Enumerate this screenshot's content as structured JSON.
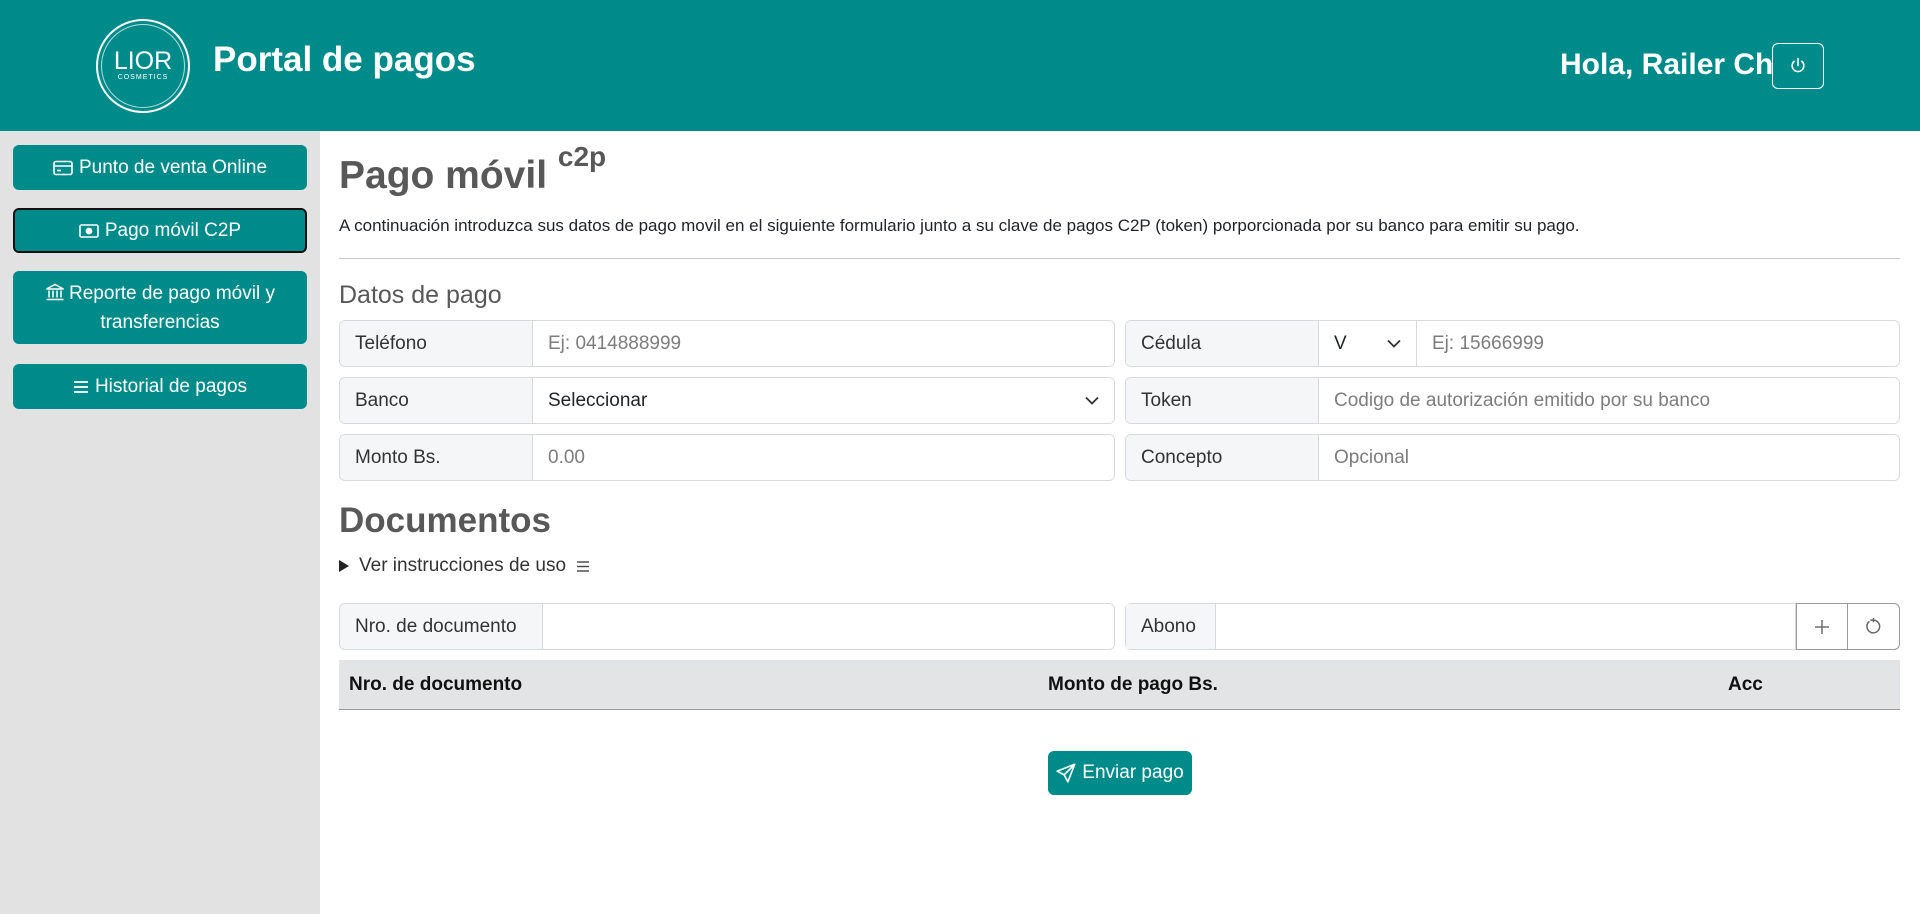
{
  "header": {
    "logo_text": "LIOR",
    "logo_subtext": "COSMETICS",
    "title": "Portal de pagos",
    "greeting": "Hola, Railer Ch"
  },
  "sidebar": {
    "items": [
      {
        "label": "Punto de venta Online",
        "icon": "card-icon"
      },
      {
        "label": "Pago móvil C2P",
        "icon": "cash-icon",
        "active": true
      },
      {
        "label": "Reporte de pago móvil y transferencias",
        "icon": "bank-icon"
      },
      {
        "label": "Historial de pagos",
        "icon": "list-icon"
      }
    ]
  },
  "main": {
    "title": "Pago móvil",
    "title_sup": "c2p",
    "lead": "A continuación introduzca sus datos de pago movil en el siguiente formulario junto a su clave de pagos C2P (token) porporcionada por su banco para emitir su pago.",
    "section_payment": "Datos de pago",
    "fields": {
      "telefono_label": "Teléfono",
      "telefono_placeholder": "Ej: 0414888999",
      "cedula_label": "Cédula",
      "cedula_type": "V",
      "cedula_placeholder": "Ej: 15666999",
      "banco_label": "Banco",
      "banco_value": "Seleccionar",
      "token_label": "Token",
      "token_placeholder": "Codigo de autorización emitido por su banco",
      "monto_label": "Monto Bs.",
      "monto_placeholder": "0.00",
      "concepto_label": "Concepto",
      "concepto_placeholder": "Opcional"
    },
    "section_documents": "Documentos",
    "instructions": "Ver instrucciones de uso",
    "doc_fields": {
      "nro_label": "Nro. de documento",
      "abono_label": "Abono"
    },
    "table": {
      "columns": [
        "Nro. de documento",
        "Monto de pago Bs.",
        "Acc"
      ]
    },
    "send_label": "Enviar pago"
  },
  "colors": {
    "primary": "#008b8b",
    "sidebar_bg": "#e2e2e2"
  }
}
